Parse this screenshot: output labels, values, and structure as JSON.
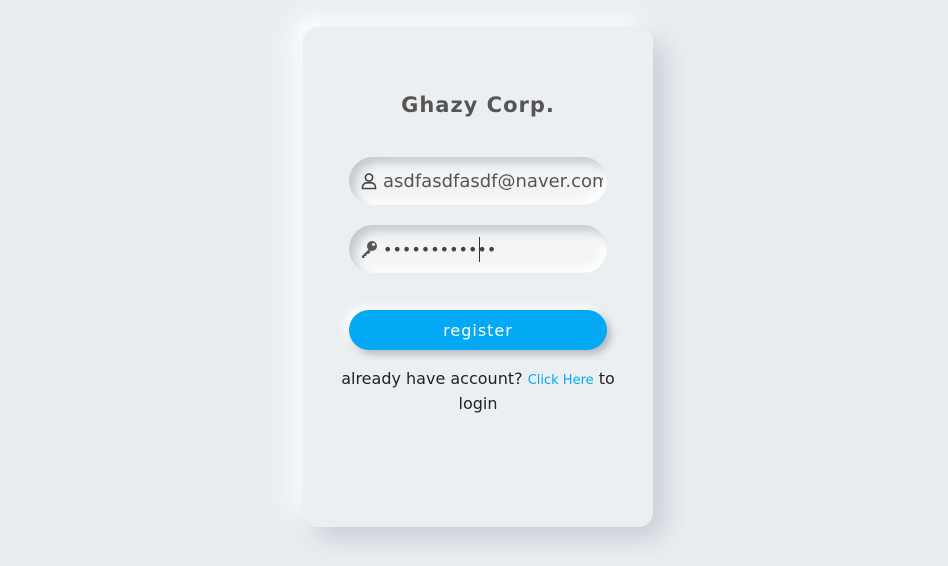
{
  "card": {
    "title": "Ghazy Corp.",
    "email_value": "asdfasdfasdf@naver.com",
    "password_value": "••••••••••••",
    "register_label": "register",
    "footer_prefix": "already have account?",
    "footer_link": "Click Here",
    "footer_suffix": "to login"
  },
  "icons": {
    "email_field": "user-icon",
    "password_field": "key-icon"
  },
  "colors": {
    "accent": "#03a9f4",
    "background": "#eaeef2"
  }
}
